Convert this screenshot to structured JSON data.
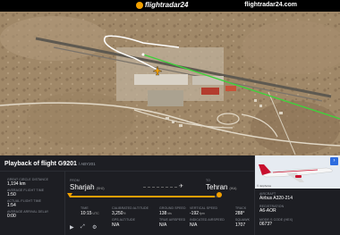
{
  "brand": {
    "logo": "flightradar24",
    "site": "flightradar24.com"
  },
  "flight": {
    "title": "Playback of flight G9201",
    "callsign": "/ ABY201",
    "from_label": "FROM",
    "from_city": "Sharjah",
    "from_code": "(SHJ)",
    "to_label": "TO",
    "to_city": "Tehran",
    "to_code": "(IKA)"
  },
  "left_stats": [
    {
      "label": "GREAT CIRCLE DISTANCE",
      "value": "1,194 km"
    },
    {
      "label": "AVERAGE FLIGHT TIME",
      "value": "1:50"
    },
    {
      "label": "ACTUAL FLIGHT TIME",
      "value": "1:54"
    },
    {
      "label": "AVERAGE ARRIVAL DELAY",
      "value": "0:00"
    }
  ],
  "stats": {
    "time_label": "TIME",
    "time": "10:15",
    "time_unit": "UTC",
    "alt_label": "CALIBRATED ALTITUDE",
    "alt": "3,250",
    "alt_unit": "ft",
    "gps_label": "GPS ALTITUDE",
    "gps": "N/A",
    "gs_label": "GROUND SPEED",
    "gs": "138",
    "gs_unit": "kts",
    "tas_label": "TRUE AIRSPEED",
    "tas": "N/A",
    "vs_label": "VERTICAL SPEED",
    "vs": "-192",
    "vs_unit": "fpm",
    "ias_label": "INDICATED AIRSPEED",
    "ias": "N/A",
    "track_label": "TRACK",
    "track": "288°",
    "squawk_label": "SQUAWK",
    "squawk": "1707"
  },
  "aircraft": {
    "type_label": "AIRCRAFT",
    "type": "Airbus A320-214",
    "reg_label": "REGISTRATION",
    "reg": "A6-AOR",
    "hex_label": "MODE-S CODE (HEX)",
    "hex": "0673?"
  },
  "photo_credit": "© Jetphotos",
  "colors": {
    "route": "#3fd13a",
    "accent": "#f2a000",
    "play": "#2d6cdf"
  },
  "icons": [
    "fr24-logo-icon",
    "plane-icon",
    "play-icon",
    "expand-icon",
    "settings-icon",
    "airplane-marker-icon"
  ]
}
